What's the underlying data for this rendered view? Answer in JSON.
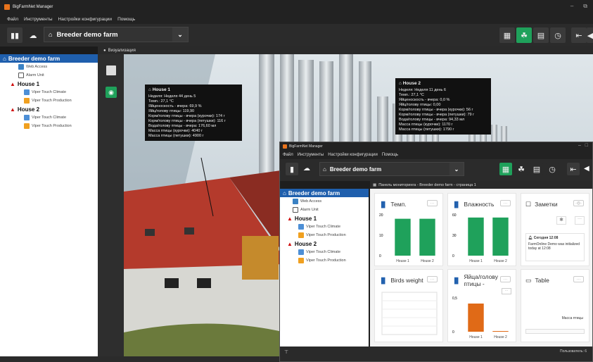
{
  "app": {
    "title": "BigFarmNet Manager"
  },
  "menu": [
    "Файл",
    "Инструменты",
    "Настройки конфигурации",
    "Помощь"
  ],
  "farm": {
    "name": "Breeder demo farm"
  },
  "tree": {
    "root": "Breeder demo farm",
    "top_items": [
      "Web Access",
      "Alarm Unit"
    ],
    "houses": [
      {
        "name": "House 1",
        "items": [
          "Viper Touch Climate",
          "Viper Touch Production"
        ]
      },
      {
        "name": "House 2",
        "items": [
          "Viper Touch Climate",
          "Viper Touch Production"
        ]
      }
    ]
  },
  "viz": {
    "tab_label": "Визуализация"
  },
  "tooltips": [
    {
      "title": "House 1",
      "lines": [
        "Неделя: Неделя 44 день 5",
        "Темп.: 27,1 °C",
        "Яйценоскость - вчера: 69,9 %",
        "Яйц/голову птицы: 119,90",
        "Корм/голову птицы - вчера (курочки): 174 г",
        "Корм/голову птицы - вчера (петушки): 116 г",
        "Вода/голову птицы - вчера: 176,60 мл",
        "Масса птицы (курочки): 4040 г",
        "Масса птицы (петушки): 4900 г"
      ]
    },
    {
      "title": "House 2",
      "lines": [
        "Неделя: Неделя 11 день 6",
        "Темп.: 27,1 °C",
        "Яйценоскость - вчера: 0,0 %",
        "Яйц/голову птицы: 0,00",
        "Корм/голову птицы - вчера (курочки): 56 г",
        "Корм/голову птицы - вчера (петушки): 79 г",
        "Вода/голову птицы - вчера: 94,33 мл",
        "Масса птицы (курочки): 1170 г",
        "Масса птицы (петушки): 1790 г"
      ]
    }
  ],
  "window2": {
    "title": "BigFarmNet Manager",
    "panel_title": "Панель мониторинга - Breeder demo farm - страница 1",
    "status_users": "Пользователь: 6"
  },
  "cards": {
    "temp": {
      "title": "Темп.",
      "yticks": [
        "20",
        "10",
        "0"
      ],
      "cats": [
        "House 1",
        "House 2"
      ]
    },
    "hum": {
      "title": "Влажность",
      "yticks": [
        "60",
        "30",
        "0"
      ],
      "cats": [
        "House 1",
        "House 2"
      ]
    },
    "notes": {
      "title": "Заметки",
      "note_date": "Сегодня 12:08",
      "note_text": "FarmOnline Demo was initialized today at 12:08"
    },
    "birds": {
      "title": "Birds weight"
    },
    "eggs": {
      "title": "Яйца/голову птицы -",
      "yticks": [
        "0,5",
        "0"
      ],
      "cats": [
        "House 1",
        "House 2"
      ]
    },
    "table": {
      "title": "Table",
      "col": "Масса птицы"
    }
  },
  "chart_data": [
    {
      "type": "bar",
      "title": "Темп.",
      "categories": [
        "House 1",
        "House 2"
      ],
      "values": [
        27.1,
        27.1
      ],
      "ylim": [
        0,
        30
      ],
      "colors": [
        "#1fa15b"
      ]
    },
    {
      "type": "bar",
      "title": "Влажность",
      "categories": [
        "House 1",
        "House 2"
      ],
      "values": [
        70,
        70
      ],
      "ylim": [
        0,
        75
      ],
      "colors": [
        "#1fa15b"
      ]
    },
    {
      "type": "bar",
      "title": "Яйца/голову птицы -",
      "categories": [
        "House 1",
        "House 2"
      ],
      "values": [
        0.5,
        0
      ],
      "ylim": [
        0,
        0.6
      ],
      "colors": [
        "#e06a17"
      ]
    }
  ],
  "colors": {
    "accent": "#1fa15b",
    "brand": "#1f5fad",
    "orange": "#e06a17"
  },
  "icons": [
    "sidebar-toggle-icon",
    "cloud-icon",
    "barn-icon",
    "grid-icon",
    "leaf-icon",
    "table-icon",
    "history-icon",
    "exit-icon",
    "volume-icon"
  ]
}
